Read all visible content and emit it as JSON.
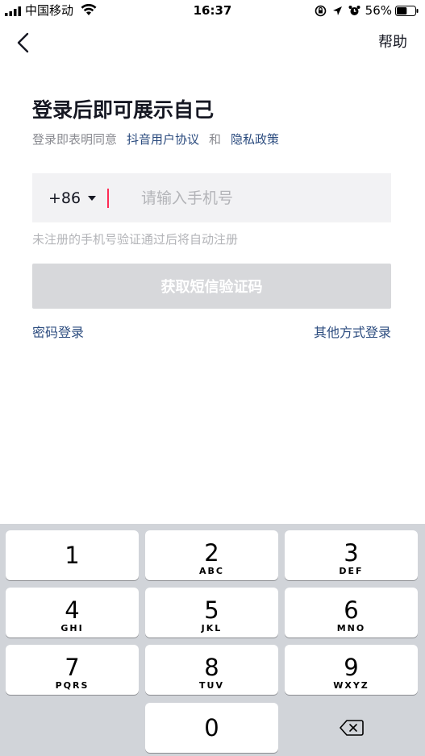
{
  "status_bar": {
    "carrier": "中国移动",
    "time": "16:37",
    "battery_percent": "56%",
    "battery_level": 0.56
  },
  "nav": {
    "help_label": "帮助"
  },
  "main": {
    "title": "登录后即可展示自己",
    "agreement_prefix": "登录即表明同意",
    "user_agreement": "抖音用户协议",
    "and": "和",
    "privacy_policy": "隐私政策",
    "country_code": "+86",
    "phone_placeholder": "请输入手机号",
    "phone_value": "",
    "hint": "未注册的手机号验证通过后将自动注册",
    "get_code_button": "获取短信验证码",
    "password_login": "密码登录",
    "other_login": "其他方式登录"
  },
  "colors": {
    "link": "#2c4c7f",
    "cursor": "#fe2c55",
    "disabled_button": "#d7d8db",
    "keyboard_bg": "#d1d4d9"
  },
  "keyboard": {
    "keys": [
      {
        "digit": "1",
        "letters": ""
      },
      {
        "digit": "2",
        "letters": "ABC"
      },
      {
        "digit": "3",
        "letters": "DEF"
      },
      {
        "digit": "4",
        "letters": "GHI"
      },
      {
        "digit": "5",
        "letters": "JKL"
      },
      {
        "digit": "6",
        "letters": "MNO"
      },
      {
        "digit": "7",
        "letters": "PQRS"
      },
      {
        "digit": "8",
        "letters": "TUV"
      },
      {
        "digit": "9",
        "letters": "WXYZ"
      },
      {
        "digit": "0",
        "letters": ""
      }
    ],
    "delete_icon": "backspace-icon"
  }
}
